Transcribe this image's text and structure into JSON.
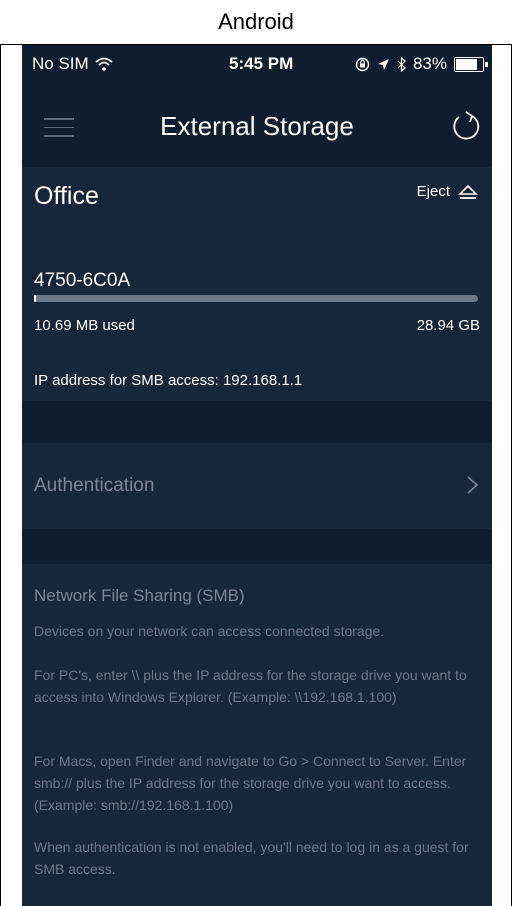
{
  "platform_label": "Android",
  "status_bar": {
    "carrier": "No SIM",
    "time": "5:45 PM",
    "battery": "83%",
    "battery_level": 0.83
  },
  "header": {
    "title": "External Storage"
  },
  "drive": {
    "name": "Office",
    "eject_label": "Eject",
    "storage_id": "4750-6C0A",
    "used": "10.69 MB used",
    "total": "28.94 GB",
    "used_fraction": 0.0004,
    "ip_text": "IP address for SMB access: 192.168.1.1"
  },
  "auth": {
    "label": "Authentication"
  },
  "smb": {
    "title": "Network File Sharing (SMB)",
    "paragraphs": [
      "Devices on your network can access connected storage.",
      "For PC's, enter \\\\ plus the IP address for the storage drive you want to access into Windows Explorer. (Example: \\\\192.168.1.100)",
      "For Macs, open Finder and navigate to Go > Connect to Server. Enter smb:// plus the IP address for the storage drive you want to access. (Example: smb://192.168.1.100)",
      "When authentication is not enabled, you'll need to log in as a guest for SMB access."
    ]
  },
  "icons": [
    "wifi-icon",
    "orientation-lock-icon",
    "location-arrow-icon",
    "bluetooth-icon",
    "battery-icon",
    "menu-icon",
    "refresh-icon",
    "eject-icon",
    "chevron-right-icon"
  ],
  "colors": {
    "background": "#0f1e2f",
    "panel": "#16273a",
    "muted_text": "#6c7888",
    "progress_track": "#6a7888"
  }
}
